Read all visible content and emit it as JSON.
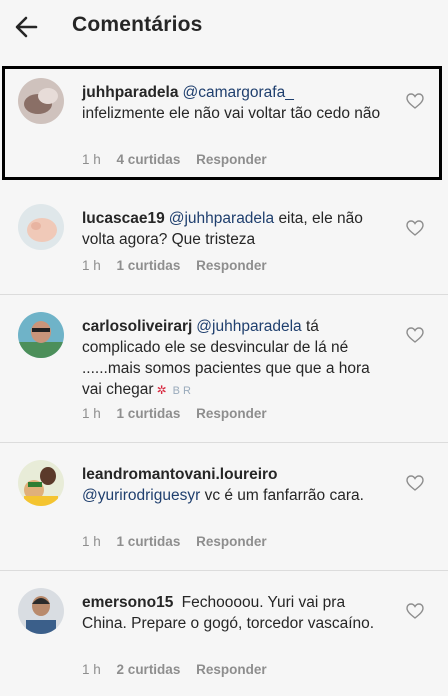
{
  "header": {
    "title": "Comentários"
  },
  "comments": [
    {
      "username": "juhhparadela",
      "mention": "@camargorafa_",
      "text": "infelizmente ele não vai voltar tão cedo não",
      "time": "1 h",
      "likes": "4 curtidas",
      "reply": "Responder"
    },
    {
      "username": "lucascae19",
      "mention": "@juhhparadela",
      "text": "eita, ele não volta agora? Que tristeza",
      "time": "1 h",
      "likes": "1 curtidas",
      "reply": "Responder"
    },
    {
      "username": "carlosoliveirarj",
      "mention": "@juhhparadela",
      "text": "tá complicado ele se desvincular de lá né ......mais somos pacientes que que a hora vai chegar",
      "emoji": "✲",
      "emoji2": "B R",
      "time": "1 h",
      "likes": "1 curtidas",
      "reply": "Responder"
    },
    {
      "username": "leandromantovani.loureiro",
      "mention": "@yurirodriguesyr",
      "text": "vc é um fanfarrão cara.",
      "time": "1 h",
      "likes": "1 curtidas",
      "reply": "Responder"
    },
    {
      "username": "emersono15",
      "mention": "",
      "text": "Fechoooou. Yuri vai pra China. Prepare o gogó, torcedor vascaíno.",
      "time": "1 h",
      "likes": "2 curtidas",
      "reply": "Responder"
    }
  ]
}
